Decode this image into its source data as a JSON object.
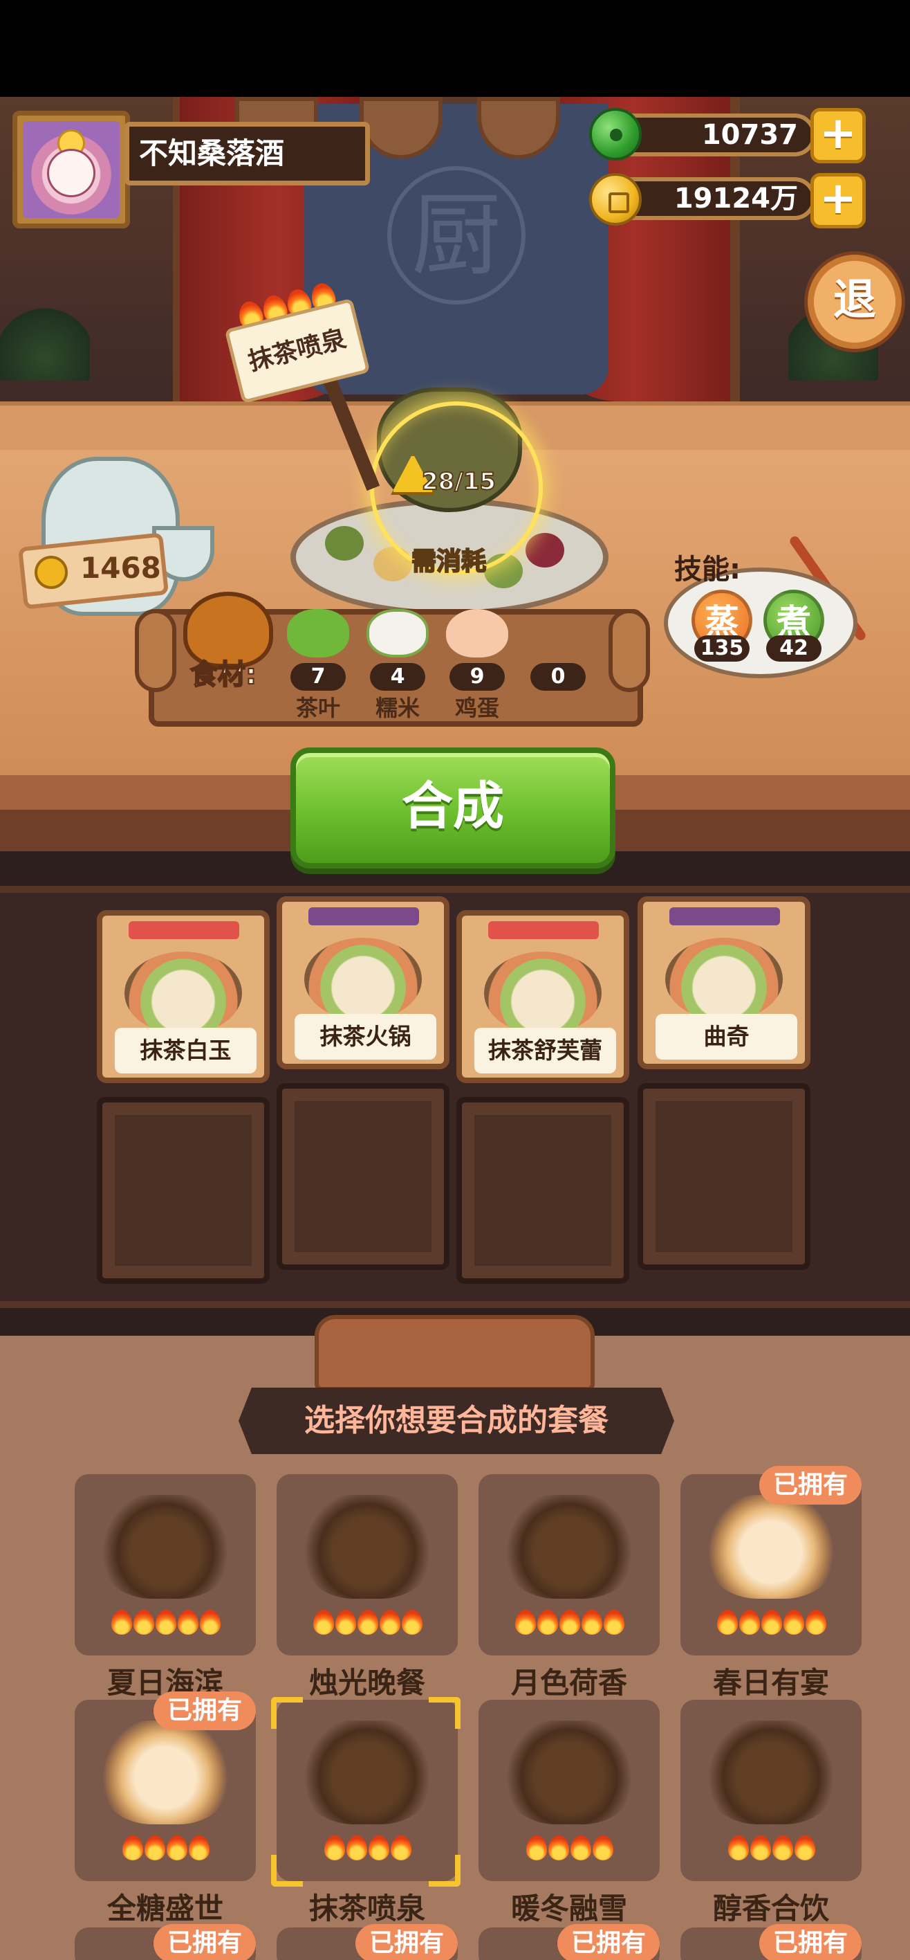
{
  "player": {
    "name": "不知桑落酒",
    "avatar_icon": "rabbit-chef-avatar"
  },
  "currencies": {
    "jade": {
      "value": "10737",
      "icon": "jade-icon"
    },
    "coins": {
      "value": "19124万",
      "icon": "coin-icon"
    },
    "plus_label": "+"
  },
  "exit_button": {
    "label": "退"
  },
  "current_dish": {
    "name": "抹茶喷泉",
    "flames": 4,
    "progress_text": "28/15",
    "consume_label": "需消耗",
    "price": "1468"
  },
  "ingredients": {
    "title": "食材:",
    "items": [
      {
        "name": "茶叶",
        "count": "7",
        "color": "#6fb83a"
      },
      {
        "name": "糯米",
        "count": "4",
        "color": "#f4f2ea"
      },
      {
        "name": "鸡蛋",
        "count": "9",
        "color": "#f8c9a8"
      },
      {
        "name": "",
        "count": "0",
        "color": "transparent"
      }
    ]
  },
  "skills": {
    "label": "技能:",
    "items": [
      {
        "name": "蒸",
        "count": "135"
      },
      {
        "name": "煮",
        "count": "42"
      }
    ]
  },
  "synthesize_button": {
    "label": "合成"
  },
  "shelf": {
    "dishes": [
      {
        "name": "抹茶白玉",
        "tier_color": "#e0524a"
      },
      {
        "name": "抹茶火锅",
        "tier_color": "#7b4a8a"
      },
      {
        "name": "抹茶舒芙蕾",
        "tier_color": "#e0524a"
      },
      {
        "name": "曲奇",
        "tier_color": "#7b4a8a"
      }
    ]
  },
  "selection": {
    "title": "选择你想要合成的套餐",
    "owned_label": "已拥有",
    "sets": [
      {
        "name": "夏日海滨",
        "flames": 5,
        "owned": false
      },
      {
        "name": "烛光晚餐",
        "flames": 5,
        "owned": false
      },
      {
        "name": "月色荷香",
        "flames": 5,
        "owned": false
      },
      {
        "name": "春日有宴",
        "flames": 5,
        "owned": true
      },
      {
        "name": "全糖盛世",
        "flames": 4,
        "owned": true
      },
      {
        "name": "抹茶喷泉",
        "flames": 4,
        "owned": false,
        "selected": true
      },
      {
        "name": "暖冬融雪",
        "flames": 4,
        "owned": false
      },
      {
        "name": "醇香合饮",
        "flames": 4,
        "owned": false
      }
    ],
    "next_row_badges": [
      "已拥有",
      "已拥有",
      "已拥有",
      "已拥有"
    ]
  }
}
